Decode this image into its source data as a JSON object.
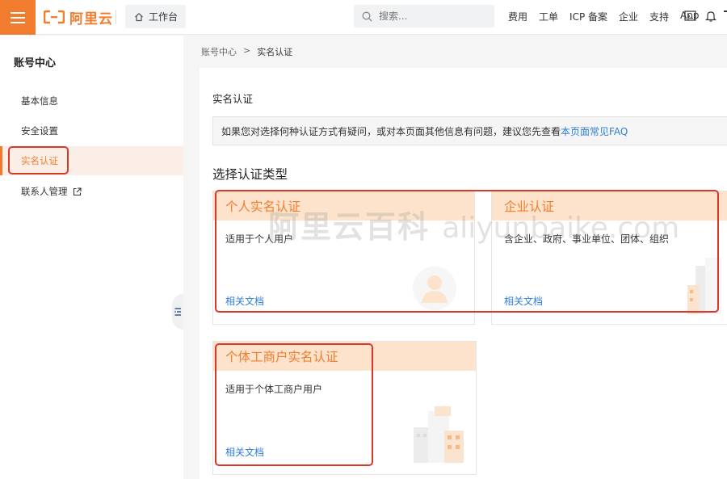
{
  "topbar": {
    "brand": "阿里云",
    "workbench_label": "工作台",
    "search_placeholder": "搜索...",
    "links": [
      "费用",
      "工单",
      "ICP 备案",
      "企业",
      "支持",
      "App"
    ]
  },
  "sidebar": {
    "title": "账号中心",
    "items": [
      {
        "label": "基本信息"
      },
      {
        "label": "安全设置"
      },
      {
        "label": "实名认证"
      },
      {
        "label": "联系人管理"
      }
    ]
  },
  "breadcrumb": {
    "parent": "账号中心",
    "separator": ">",
    "current": "实名认证"
  },
  "main": {
    "title": "实名认证",
    "notice_text": "如果您对选择何种认证方式有疑问，或对本页面其他信息有问题，建议您先查看",
    "notice_link": "本页面常见FAQ",
    "section_title": "选择认证类型",
    "cards": [
      {
        "title": "个人实名认证",
        "desc": "适用于个人用户",
        "link": "相关文档"
      },
      {
        "title": "企业认证",
        "desc": "含企业、政府、事业单位、团体、组织",
        "link": "相关文档"
      },
      {
        "title": "个体工商户实名认证",
        "desc": "适用于个体工商户用户",
        "link": "相关文档"
      }
    ]
  },
  "watermark": {
    "cn": "阿里云百科",
    "en": "aliyunbaike.com"
  },
  "colors": {
    "brand": "#f27c2e",
    "link": "#2e7fd6",
    "highlight": "#d8382a",
    "card_head": "#fde3cc"
  }
}
